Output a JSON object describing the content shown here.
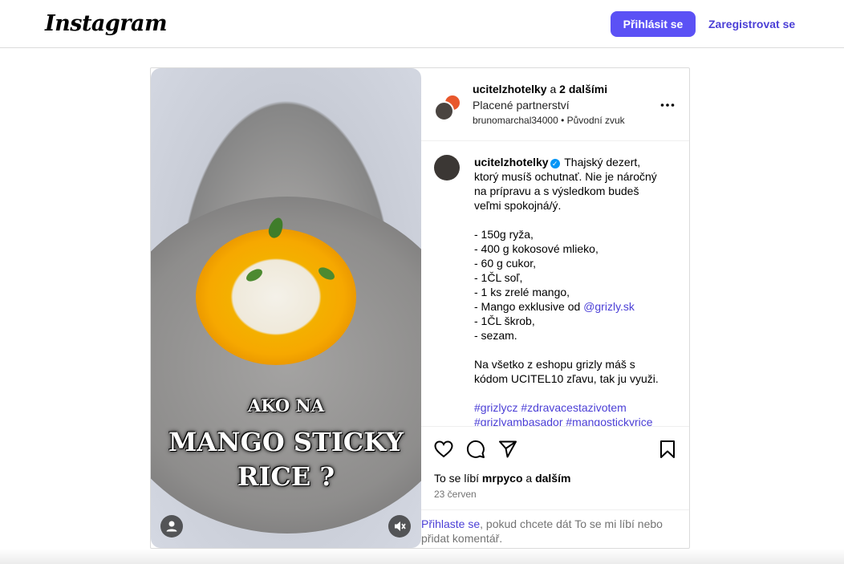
{
  "nav": {
    "logo": "Instagram",
    "login_label": "Přihlásit se",
    "register_label": "Zaregistrovat se"
  },
  "media": {
    "overlay_line1": "AKO NA",
    "overlay_line2": "MANGO STICKY",
    "overlay_line3": "RICE ?",
    "icons": [
      "user-icon",
      "muted-speaker-icon"
    ]
  },
  "header": {
    "username": "ucitelzhotelky",
    "and_text": " a ",
    "others": "2 dalšími",
    "partnership": "Placené partnerství",
    "audio_user": "brunomarchal34000",
    "audio_sep": " • ",
    "audio_label": "Původní zvuk"
  },
  "caption": {
    "username": "ucitelzhotelky",
    "intro": " Thajský dezert, ktorý musíš ochutnať. Nie je náročný na prípravu a s výsledkom budeš veľmi spokojná/ý.\n\n- 150g ryža,\n- 400 g kokosové mlieko,\n- 60 g cukor,\n- 1ČL soľ,\n- 1 ks zrelé mango,\n- Mango exklusive od ",
    "mention": "@grizly.sk",
    "rest": "\n- 1ČL škrob,\n- sezam.\n\nNa všetko z eshopu grizly máš s kódom UCITEL10 zľavu, tak ju využi.\n\n",
    "hashtags": "#grizlycz #zdravacestazivotem #grizlyambasador #mangostickyrice"
  },
  "actions": {
    "icons": [
      "heart-icon",
      "comment-icon",
      "share-icon",
      "bookmark-icon"
    ],
    "likes_prefix": "To se líbí ",
    "likes_user": "mrpyco",
    "likes_mid": " a ",
    "likes_others": "dalším",
    "date": "23 červen"
  },
  "login_prompt": {
    "link": "Přihlaste se",
    "text": ", pokud chcete dát To se mi líbí nebo přidat komentář."
  },
  "colors": {
    "primary_button": "#5b51f5",
    "link": "#4b3fd6",
    "verified": "#0095f6",
    "border": "#dbdbdb"
  }
}
